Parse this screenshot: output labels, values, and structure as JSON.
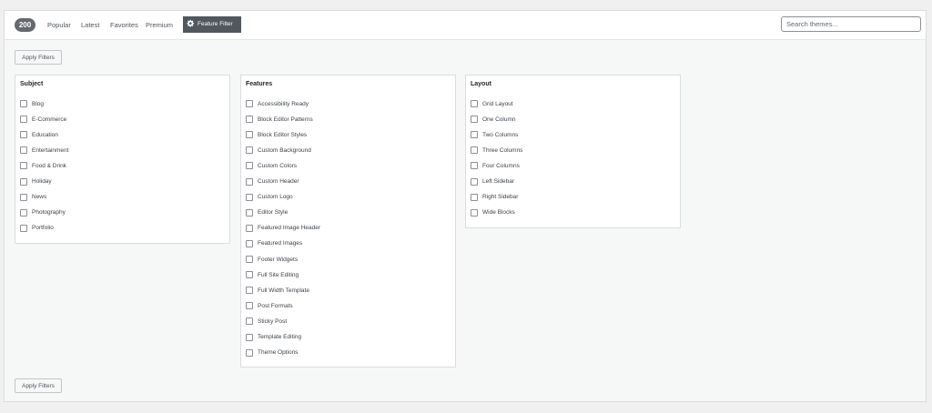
{
  "header": {
    "count": "200",
    "tabs": [
      "Popular",
      "Latest",
      "Favorites",
      "Premium"
    ],
    "feature_filter_label": "Feature Filter",
    "search_placeholder": "Search themes..."
  },
  "apply_label": "Apply Filters",
  "groups": [
    {
      "title": "Subject",
      "options": [
        "Blog",
        "E-Commerce",
        "Education",
        "Entertainment",
        "Food & Drink",
        "Holiday",
        "News",
        "Photography",
        "Portfolio"
      ]
    },
    {
      "title": "Features",
      "options": [
        "Accessibility Ready",
        "Block Editor Patterns",
        "Block Editor Styles",
        "Custom Background",
        "Custom Colors",
        "Custom Header",
        "Custom Logo",
        "Editor Style",
        "Featured Image Header",
        "Featured Images",
        "Footer Widgets",
        "Full Site Editing",
        "Full Width Template",
        "Post Formats",
        "Sticky Post",
        "Template Editing",
        "Theme Options"
      ]
    },
    {
      "title": "Layout",
      "options": [
        "Grid Layout",
        "One Column",
        "Two Columns",
        "Three Columns",
        "Four Columns",
        "Left Sidebar",
        "Right Sidebar",
        "Wide Blocks"
      ]
    }
  ]
}
